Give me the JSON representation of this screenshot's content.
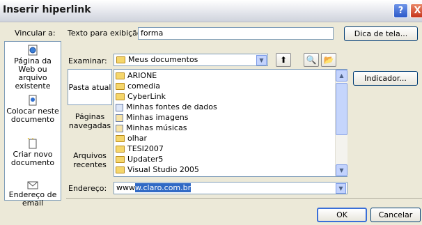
{
  "window": {
    "title": "Inserir hiperlink"
  },
  "title_buttons": {
    "help": "?",
    "close": "X"
  },
  "link_to": {
    "label": "Vincular a:",
    "items": [
      {
        "label": "Página da Web ou arquivo existente",
        "icon": "globe-page-icon"
      },
      {
        "label": "Colocar neste documento",
        "icon": "document-place-icon"
      },
      {
        "label": "Criar novo documento",
        "icon": "new-document-icon"
      },
      {
        "label": "Endereço de email",
        "icon": "email-icon"
      }
    ]
  },
  "display_text": {
    "label": "Texto para exibição:",
    "value": "forma"
  },
  "screen_tip_button": "Dica de tela...",
  "look_in": {
    "label": "Examinar:",
    "value": "Meus documentos"
  },
  "places": [
    {
      "label": "Pasta atual"
    },
    {
      "label": "Páginas navegadas"
    },
    {
      "label": "Arquivos recentes"
    }
  ],
  "files": [
    {
      "name": "ARIONE",
      "icon": "folder-icon"
    },
    {
      "name": "comedia",
      "icon": "folder-icon"
    },
    {
      "name": "CyberLink",
      "icon": "folder-icon"
    },
    {
      "name": "Minhas fontes de dados",
      "icon": "data-sources-icon"
    },
    {
      "name": "Minhas imagens",
      "icon": "pictures-folder-icon"
    },
    {
      "name": "Minhas músicas",
      "icon": "music-folder-icon"
    },
    {
      "name": "olhar",
      "icon": "folder-icon"
    },
    {
      "name": "TESI2007",
      "icon": "folder-icon"
    },
    {
      "name": "Updater5",
      "icon": "folder-icon"
    },
    {
      "name": "Visual Studio 2005",
      "icon": "folder-icon"
    }
  ],
  "bookmark_button": "Indicador...",
  "address": {
    "label": "Endereço:",
    "value_prefix": "www",
    "value_selected": "w.claro.com.br"
  },
  "ok_button": "OK",
  "cancel_button": "Cancelar"
}
